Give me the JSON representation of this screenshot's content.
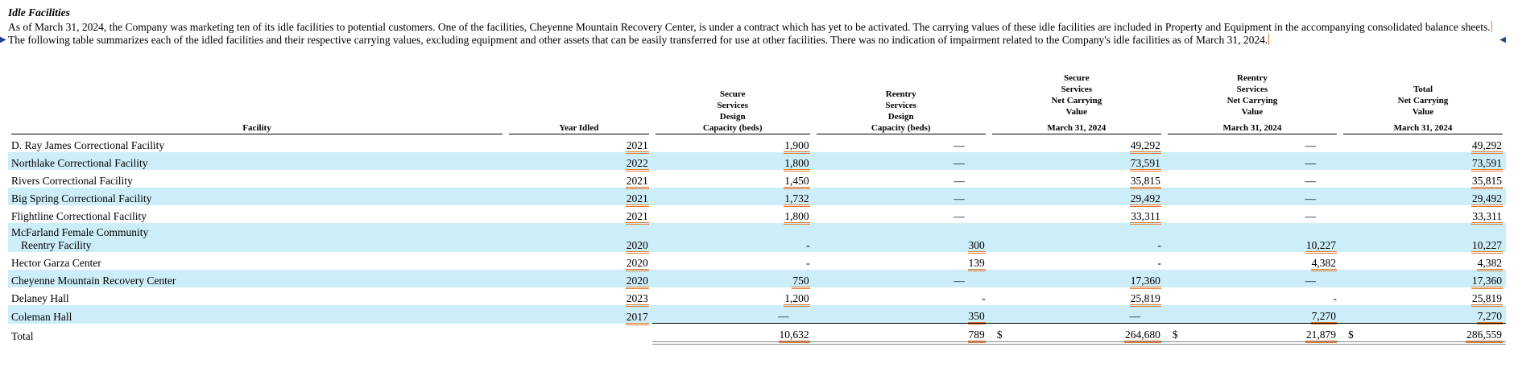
{
  "section": {
    "heading": "Idle Facilities",
    "para_part1": "As of March 31, 2024, the Company was marketing ten of its idle facilities to potential customers. One of the facilities, Cheyenne Mountain Recovery Center, is under a contract which has yet to be activated. The carrying values of these idle facilities are included in Property and Equipment in the accompanying consolidated balance sheets.",
    "para_part2": "The following table summarizes each of the idled facilities and their respective carrying values, excluding equipment and other assets that can be easily transferred for use at other facilities. There was no indication of impairment related to the Company's idle facilities as of March 31, 2024."
  },
  "table": {
    "headers": {
      "facility": "Facility",
      "year_idled": "Year Idled",
      "secure_design": [
        "Secure",
        "Services",
        "Design",
        "Capacity (beds)"
      ],
      "reentry_design": [
        "Reentry",
        "Services",
        "Design",
        "Capacity (beds)"
      ],
      "secure_ncv": [
        "Secure",
        "Services",
        "Net Carrying",
        "Value",
        "",
        "March 31, 2024"
      ],
      "reentry_ncv": [
        "Reentry",
        "Services",
        "Net Carrying",
        "Value",
        "",
        "March 31, 2024"
      ],
      "total_ncv": [
        "Total",
        "Net Carrying",
        "Value",
        "",
        "March 31, 2024"
      ]
    },
    "rows": [
      {
        "facility": "D. Ray James Correctional Facility",
        "year": "2021",
        "secure_beds": "1,900",
        "reentry_beds": "—",
        "secure_value": "49,292",
        "reentry_value": "—",
        "total_value": "49,292"
      },
      {
        "facility": "Northlake Correctional Facility",
        "year": "2022",
        "secure_beds": "1,800",
        "reentry_beds": "—",
        "secure_value": "73,591",
        "reentry_value": "—",
        "total_value": "73,591"
      },
      {
        "facility": "Rivers Correctional Facility",
        "year": "2021",
        "secure_beds": "1,450",
        "reentry_beds": "—",
        "secure_value": "35,815",
        "reentry_value": "—",
        "total_value": "35,815"
      },
      {
        "facility": "Big Spring Correctional Facility",
        "year": "2021",
        "secure_beds": "1,732",
        "reentry_beds": "—",
        "secure_value": "29,492",
        "reentry_value": "—",
        "total_value": "29,492"
      },
      {
        "facility": "Flightline Correctional Facility",
        "year": "2021",
        "secure_beds": "1,800",
        "reentry_beds": "—",
        "secure_value": "33,311",
        "reentry_value": "—",
        "total_value": "33,311"
      },
      {
        "facility": "McFarland Female Community",
        "facility_line2": "Reentry Facility",
        "year": "2020",
        "secure_beds": "-",
        "reentry_beds": "300",
        "secure_value": "-",
        "reentry_value": "10,227",
        "total_value": "10,227"
      },
      {
        "facility": "Hector Garza Center",
        "year": "2020",
        "secure_beds": "-",
        "reentry_beds": "139",
        "secure_value": "-",
        "reentry_value": "4,382",
        "total_value": "4,382"
      },
      {
        "facility": "Cheyenne Mountain Recovery Center",
        "year": "2020",
        "secure_beds": "750",
        "reentry_beds": "—",
        "secure_value": "17,360",
        "reentry_value": "—",
        "total_value": "17,360"
      },
      {
        "facility": "Delaney Hall",
        "year": "2023",
        "secure_beds": "1,200",
        "reentry_beds": "-",
        "secure_value": "25,819",
        "reentry_value": "-",
        "total_value": "25,819"
      },
      {
        "facility": "Coleman Hall",
        "year": "2017",
        "secure_beds": "—",
        "reentry_beds": "350",
        "secure_value": "—",
        "reentry_value": "7,270",
        "total_value": "7,270"
      }
    ],
    "total": {
      "label": "Total",
      "secure_beds": "10,632",
      "reentry_beds": "789",
      "currency": "$",
      "secure_value": "264,680",
      "reentry_value": "21,879",
      "total_value": "286,559"
    }
  },
  "colors": {
    "row_shade": "#cdeef9",
    "underline": "#e07a2e"
  }
}
